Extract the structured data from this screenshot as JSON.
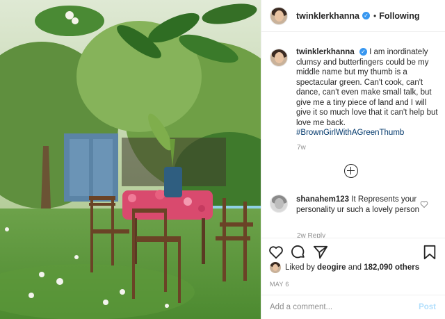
{
  "post": {
    "image_alt": "Garden with wooden table covered in flower petals",
    "header": {
      "username": "twinklerkhanna",
      "separator": "•",
      "follow_label": "Following"
    },
    "caption": {
      "username": "twinklerkhanna",
      "text": "I am inordinately clumsy and butterfingers could be my middle name but my thumb is a spectacular green. Can't cook, can't dance, can't even make small talk, but give me a tiny piece of land and I will give it so much love that it can't help but love me back.",
      "hashtag": "#BrownGirlWithAGreenThumb",
      "time": "7w"
    },
    "comments": [
      {
        "username": "shanahem123",
        "text": "It Represents your personality ur such a lovely person",
        "meta": "2w   Reply"
      }
    ],
    "likes": {
      "prefix": "Liked by",
      "user": "deogire",
      "joiner": "and",
      "count_text": "182,090 others"
    },
    "date": "MAY 6",
    "add_comment": {
      "placeholder": "Add a comment...",
      "post_label": "Post"
    }
  },
  "icons": {
    "verified": "verified-badge-icon",
    "load_more": "plus-circle-icon",
    "comment_like": "heart-outline-icon",
    "like": "heart-icon",
    "comment": "comment-bubble-icon",
    "share": "paper-plane-icon",
    "save": "bookmark-icon"
  },
  "colors": {
    "link": "#00376b",
    "verified": "#3897f0",
    "muted": "#8e8e8e",
    "post_disabled": "#b2dffc"
  }
}
